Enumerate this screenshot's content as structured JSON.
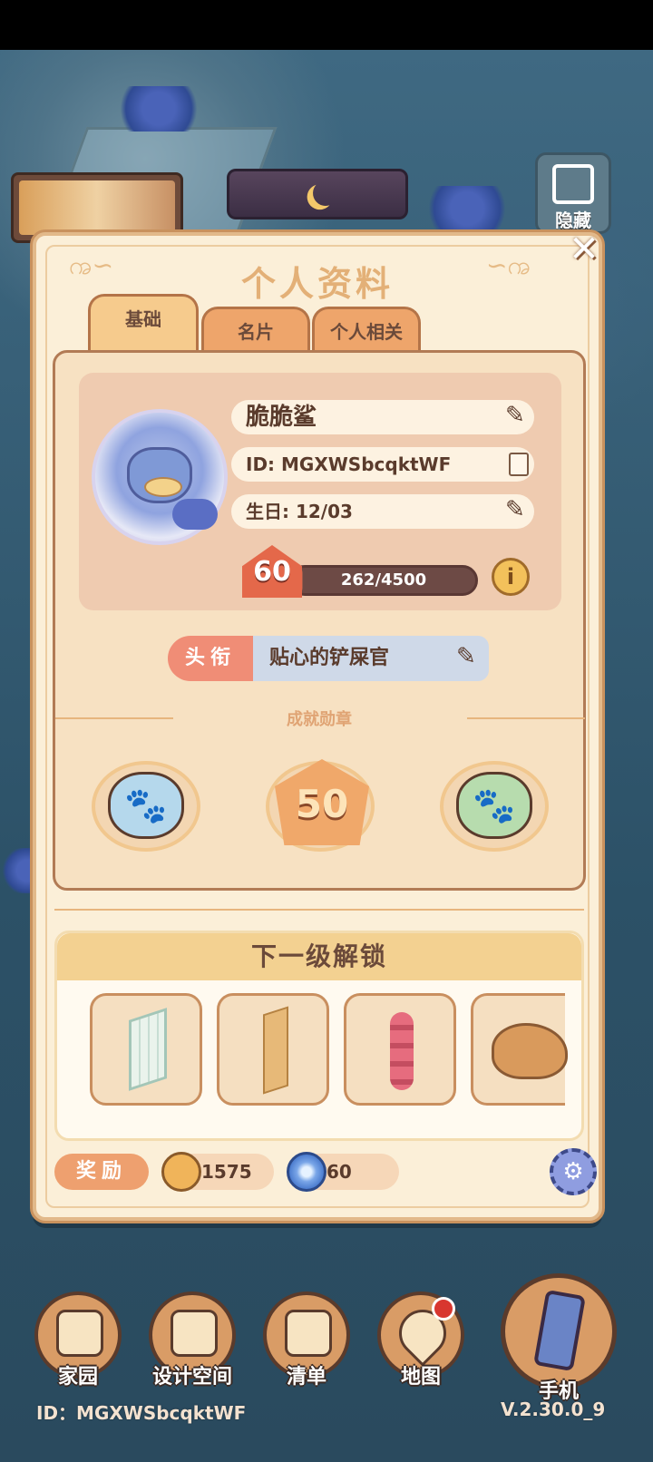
{
  "background": {
    "hide_label": "隐藏"
  },
  "panel": {
    "title": "个人资料",
    "tabs": [
      {
        "label": "基础",
        "active": true
      },
      {
        "label": "名片",
        "active": false
      },
      {
        "label": "个人相关",
        "active": false
      }
    ],
    "profile": {
      "name": "脆脆鲨",
      "id": "ID: MGXWSbcqktWF",
      "birthday": "生日: 12/03",
      "level": "60",
      "xp_text": "262/4500",
      "xp_fraction": 0.058
    },
    "title_row": {
      "label": "头衔",
      "value": "贴心的铲屎官"
    },
    "medals_header": "成就勋章",
    "medals": [
      {
        "name": "paw-blue"
      },
      {
        "name": "level-50",
        "text": "50"
      },
      {
        "name": "paw-green"
      }
    ],
    "unlock": {
      "header": "下一级解锁",
      "items": [
        "window",
        "wood-panel",
        "flower-vine",
        "capybara"
      ]
    },
    "reward": {
      "label": "奖励",
      "coins": "1575",
      "gems": "60"
    }
  },
  "bottom_nav": [
    {
      "label": "家园",
      "icon": "home-icon"
    },
    {
      "label": "设计空间",
      "icon": "design-icon"
    },
    {
      "label": "清单",
      "icon": "list-icon"
    },
    {
      "label": "地图",
      "icon": "map-icon"
    },
    {
      "label": "手机",
      "icon": "phone-icon"
    }
  ],
  "footer": {
    "id": "ID：MGXWSbcqktWF",
    "version": "V.2.30.0_9"
  }
}
